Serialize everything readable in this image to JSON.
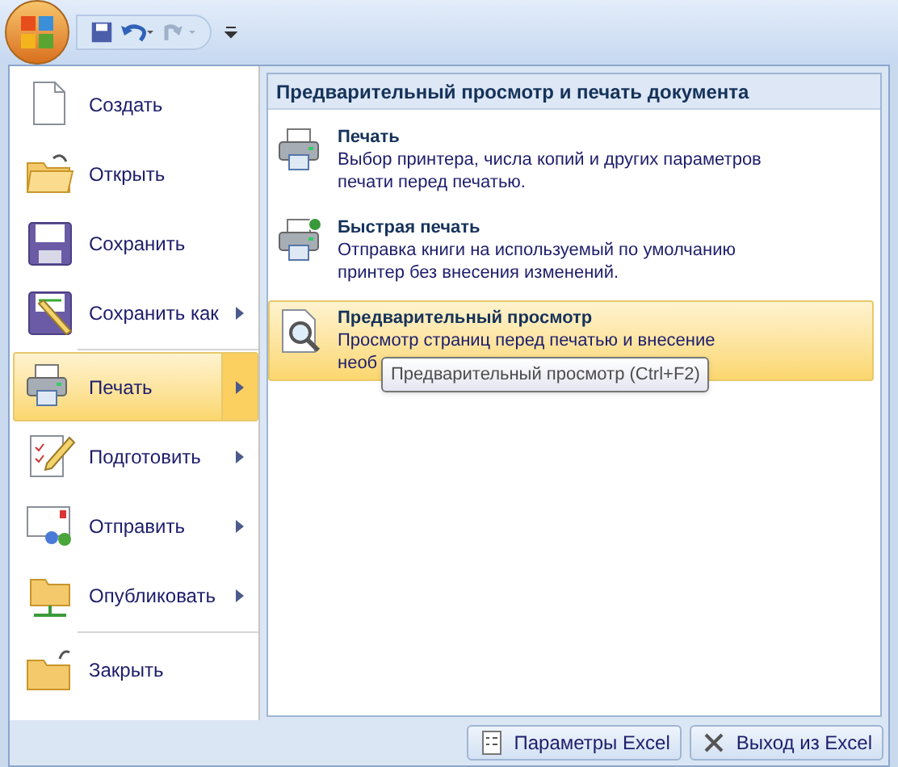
{
  "quick_access": [
    {
      "kind": "save"
    },
    {
      "kind": "undo",
      "disabled": false
    },
    {
      "kind": "redo",
      "disabled": true
    },
    {
      "kind": "customize"
    }
  ],
  "menu": [
    {
      "label": "Создать",
      "kind": "new",
      "submenu": false,
      "selected": false
    },
    {
      "label": "Открыть",
      "kind": "open",
      "submenu": false,
      "selected": false
    },
    {
      "label": "Сохранить",
      "kind": "save",
      "submenu": false,
      "selected": false
    },
    {
      "label": "Сохранить как",
      "kind": "saveas",
      "submenu": true,
      "selected": false
    },
    {
      "label": "Печать",
      "kind": "print",
      "submenu": true,
      "selected": true
    },
    {
      "label": "Подготовить",
      "kind": "prepare",
      "submenu": true,
      "selected": false
    },
    {
      "label": "Отправить",
      "kind": "send",
      "submenu": true,
      "selected": false
    },
    {
      "label": "Опубликовать",
      "kind": "publish",
      "submenu": true,
      "selected": false
    },
    {
      "label": "Закрыть",
      "kind": "close",
      "submenu": false,
      "selected": false
    }
  ],
  "submenu": {
    "title": "Предварительный просмотр и печать документа",
    "items": [
      {
        "label": "Печать",
        "description": [
          "Выбор принтера, числа копий и других параметров",
          "печати перед печатью."
        ],
        "kind": "print",
        "selected": false
      },
      {
        "label": "Быстрая печать",
        "description": [
          "Отправка книги на используемый по умолчанию",
          "принтер без внесения изменений."
        ],
        "kind": "quickprint",
        "selected": false
      },
      {
        "label": "Предварительный просмотр",
        "description": [
          "Просмотр страниц перед печатью и внесение",
          "необ"
        ],
        "kind": "preview",
        "selected": true
      }
    ]
  },
  "tooltip": "Предварительный просмотр (Ctrl+F2)",
  "buttons": [
    {
      "label": "Параметры Excel",
      "kind": "options"
    },
    {
      "label": "Выход из Excel",
      "kind": "exit"
    }
  ]
}
